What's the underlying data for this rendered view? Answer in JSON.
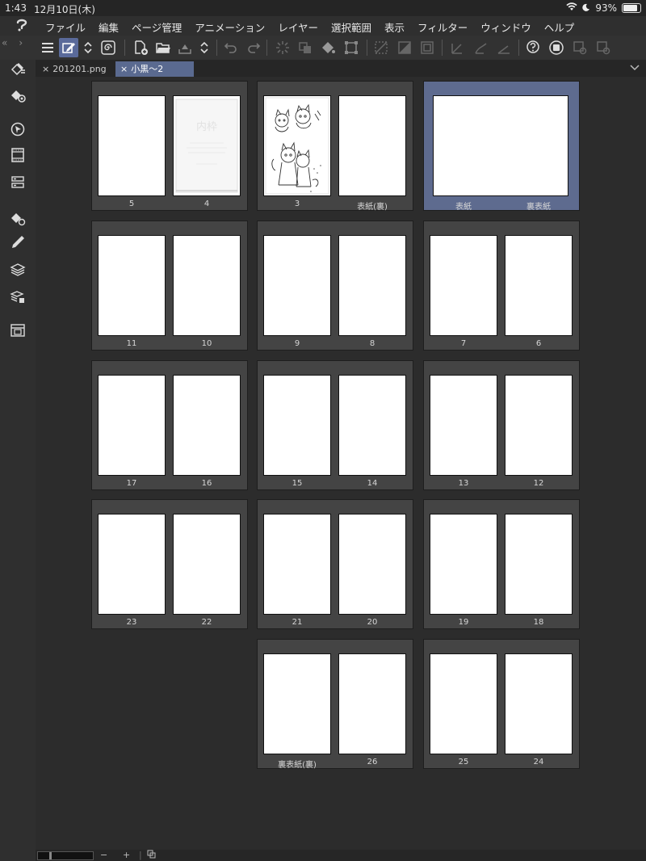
{
  "status": {
    "time": "1:43",
    "date": "12月10日(木)",
    "battery": "93%",
    "battery_level": 0.93
  },
  "menu": [
    "ファイル",
    "編集",
    "ページ管理",
    "アニメーション",
    "レイヤー",
    "選択範囲",
    "表示",
    "フィルター",
    "ウィンドウ",
    "ヘルプ"
  ],
  "tabs": [
    {
      "label": "201201.png"
    },
    {
      "label": "小黒〜2"
    }
  ],
  "spreads": [
    {
      "left": "5",
      "right": "4",
      "right_art": "inner-frame"
    },
    {
      "left": "3",
      "right": "表紙(裏)",
      "left_art": "drawing"
    },
    {
      "left": "表紙",
      "right": "裏表紙",
      "wide": true,
      "selected": true
    },
    {
      "left": "11",
      "right": "10"
    },
    {
      "left": "9",
      "right": "8"
    },
    {
      "left": "7",
      "right": "6"
    },
    {
      "left": "17",
      "right": "16"
    },
    {
      "left": "15",
      "right": "14"
    },
    {
      "left": "13",
      "right": "12"
    },
    {
      "left": "23",
      "right": "22"
    },
    {
      "left": "21",
      "right": "20"
    },
    {
      "left": "19",
      "right": "18"
    },
    {
      "left": "裏表紙(裏)",
      "right": "26"
    },
    {
      "left": "25",
      "right": "24"
    }
  ],
  "inner_frame_title": "内枠",
  "bottom": {
    "minus": "−",
    "plus": "+"
  }
}
